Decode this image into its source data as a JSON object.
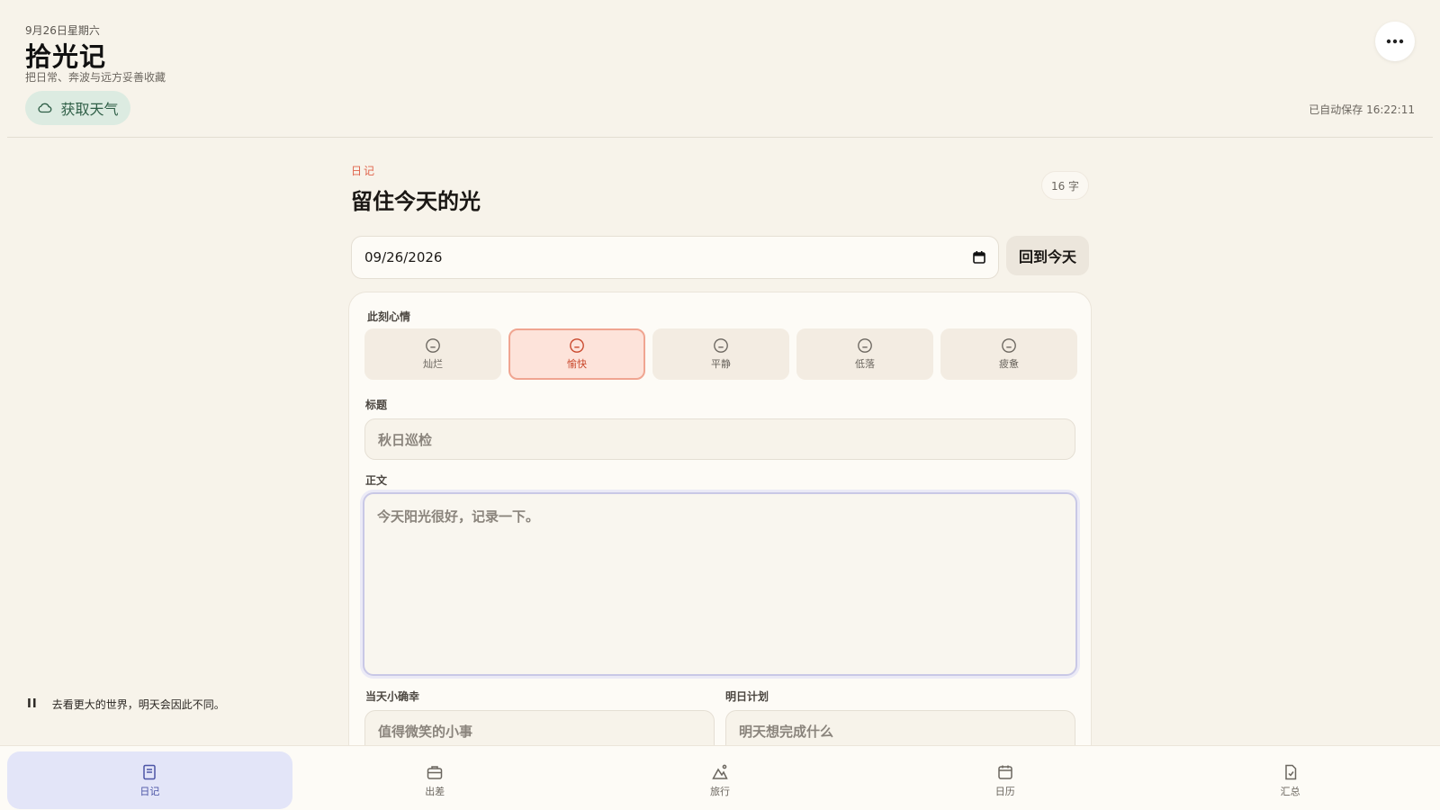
{
  "header": {
    "date_line": "9月26日星期六",
    "app_title": "拾光记",
    "subtitle": "把日常、奔波与远方妥善收藏",
    "weather_button": "获取天气",
    "saved_status": "已自动保存 16:22:11"
  },
  "editor": {
    "eyebrow": "日记",
    "title": "留住今天的光",
    "word_count": "16 字",
    "date_value": "09/26/2026",
    "today_button": "回到今天",
    "mood_label": "此刻心情",
    "moods": [
      {
        "label": "灿烂",
        "active": false
      },
      {
        "label": "愉快",
        "active": true
      },
      {
        "label": "平静",
        "active": false
      },
      {
        "label": "低落",
        "active": false
      },
      {
        "label": "疲惫",
        "active": false
      }
    ],
    "title_label": "标题",
    "title_value": "秋日巡检",
    "body_label": "正文",
    "body_value": "今天阳光很好，记录一下。",
    "joy_label": "当天小确幸",
    "joy_placeholder": "值得微笑的小事",
    "plan_label": "明日计划",
    "plan_placeholder": "明天想完成什么"
  },
  "quote": {
    "pause_icon": "II",
    "text": "去看更大的世界，明天会因此不同。"
  },
  "nav": [
    {
      "label": "日记",
      "icon": "diary-icon",
      "active": true
    },
    {
      "label": "出差",
      "icon": "briefcase-icon",
      "active": false
    },
    {
      "label": "旅行",
      "icon": "mountain-icon",
      "active": false
    },
    {
      "label": "日历",
      "icon": "calendar-icon",
      "active": false
    },
    {
      "label": "汇总",
      "icon": "summary-icon",
      "active": false
    }
  ],
  "colors": {
    "background": "#f7f3ea",
    "accent": "#e0644c",
    "weather_bg": "#dcebe1",
    "nav_active": "#e3e5f8"
  }
}
